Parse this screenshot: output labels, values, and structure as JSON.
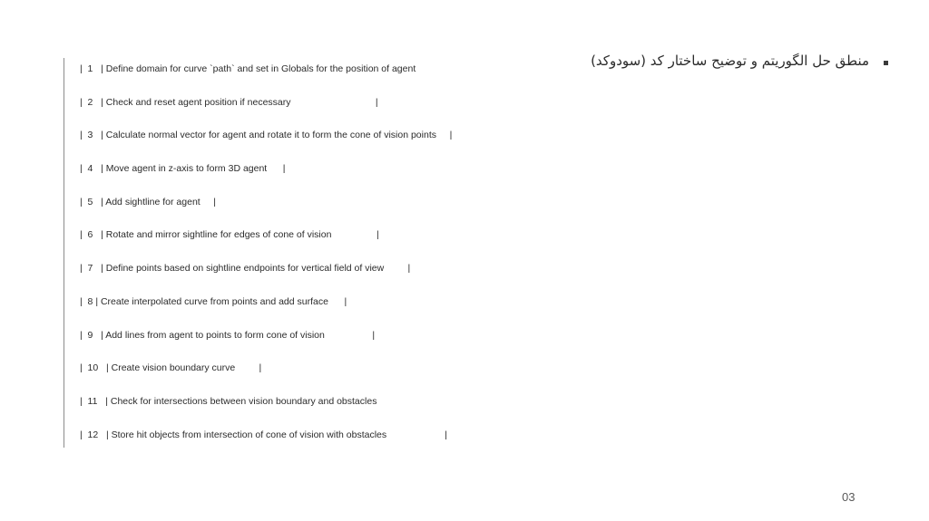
{
  "slide": {
    "heading": "منطق حل الگوریتم و توضیح ساختار کد (سودوکد)",
    "bullet_icon": "square-bullet",
    "page_number": "03",
    "steps": [
      "|  1   | Define domain for curve `path` and set in Globals for the position of agent",
      "|  2   | Check and reset agent position if necessary                                |",
      "|  3   | Calculate normal vector for agent and rotate it to form the cone of vision points     |",
      "|  4   | Move agent in z-axis to form 3D agent      |",
      "|  5   | Add sightline for agent     |",
      "|  6   | Rotate and mirror sightline for edges of cone of vision                 |",
      "|  7   | Define points based on sightline endpoints for vertical field of view         |",
      "|  8 | Create interpolated curve from points and add surface      |",
      "|  9   | Add lines from agent to points to form cone of vision                  |",
      "|  10   | Create vision boundary curve         |",
      "|  11   | Check for intersections between vision boundary and obstacles",
      "|  12   | Store hit objects from intersection of cone of vision with obstacles                      |"
    ]
  }
}
